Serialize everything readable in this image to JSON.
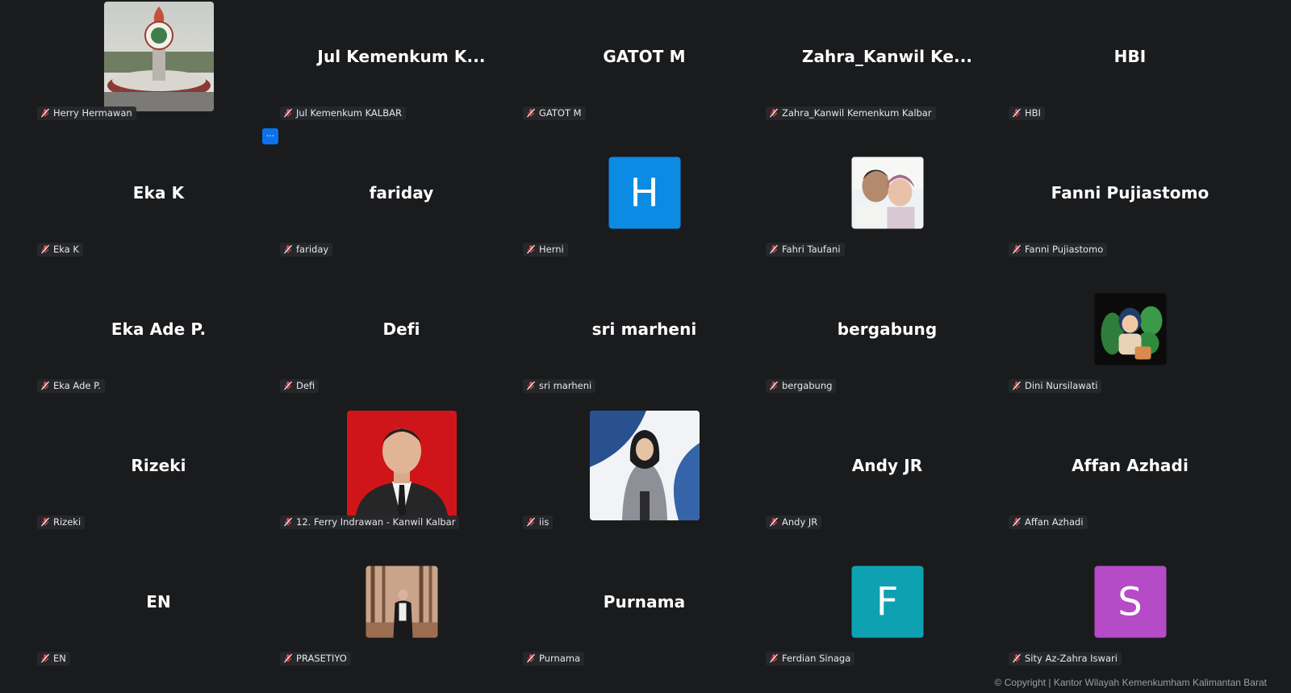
{
  "colors": {
    "background": "#1a1b1d",
    "mute_icon": "#e5484d",
    "more_button": "#0e71eb"
  },
  "more_button": {
    "label": "···"
  },
  "participants": [
    {
      "display_name": "",
      "label": "Herry Hermawan",
      "avatar": "photo-monument"
    },
    {
      "display_name": "Jul  Kemenkum  K...",
      "label": "Jul Kemenkum KALBAR"
    },
    {
      "display_name": "GATOT M",
      "label": "GATOT M"
    },
    {
      "display_name": "Zahra_Kanwil  Ke...",
      "label": "Zahra_Kanwil Kemenkum Kalbar"
    },
    {
      "display_name": "HBI",
      "label": "HBI"
    },
    {
      "display_name": "Eka K",
      "label": "Eka K"
    },
    {
      "display_name": "fariday",
      "label": "fariday"
    },
    {
      "display_name": "",
      "label": "Herni",
      "avatar": "letter",
      "letter": "H",
      "avatar_color": "#0b8be3"
    },
    {
      "display_name": "",
      "label": "Fahri Taufani",
      "avatar": "photo-father-child"
    },
    {
      "display_name": "Fanni Pujiastomo",
      "label": "Fanni Pujiastomo"
    },
    {
      "display_name": "Eka Ade P.",
      "label": "Eka Ade P."
    },
    {
      "display_name": "Defi",
      "label": "Defi"
    },
    {
      "display_name": "sri marheni",
      "label": "sri marheni"
    },
    {
      "display_name": "bergabung",
      "label": "bergabung"
    },
    {
      "display_name": "",
      "label": "Dini Nursilawati",
      "avatar": "photo-cartoon-plants"
    },
    {
      "display_name": "Rizeki",
      "label": "Rizeki"
    },
    {
      "display_name": "",
      "label": "12. Ferry Indrawan - Kanwil Kalbar",
      "avatar": "photo-man-suit"
    },
    {
      "display_name": "",
      "label": "iis",
      "avatar": "photo-woman-hijab"
    },
    {
      "display_name": "Andy JR",
      "label": "Andy JR"
    },
    {
      "display_name": "Affan Azhadi",
      "label": "Affan Azhadi"
    },
    {
      "display_name": "EN",
      "label": "EN"
    },
    {
      "display_name": "",
      "label": "PRASETIYO",
      "avatar": "photo-forest-man"
    },
    {
      "display_name": "Purnama",
      "label": "Purnama"
    },
    {
      "display_name": "",
      "label": "Ferdian Sinaga",
      "avatar": "letter",
      "letter": "F",
      "avatar_color": "#0ea1b2"
    },
    {
      "display_name": "",
      "label": "Sity Az-Zahra Iswari",
      "avatar": "letter",
      "letter": "S",
      "avatar_color": "#b54bc6"
    }
  ],
  "footer": {
    "copyright": "© Copyright | Kantor Wilayah Kemenkumham Kalimantan Barat"
  }
}
